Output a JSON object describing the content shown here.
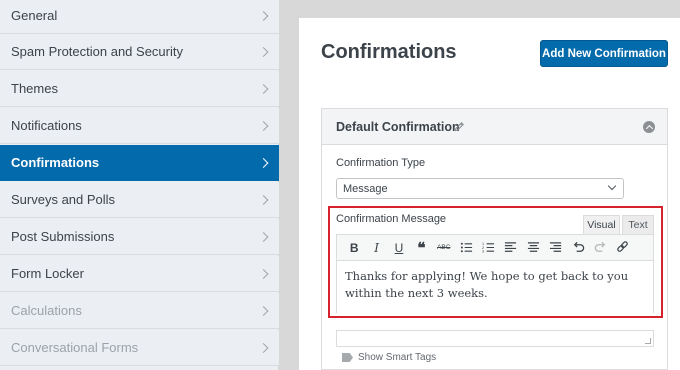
{
  "sidebar": {
    "items": [
      {
        "label": "General",
        "state": "normal"
      },
      {
        "label": "Spam Protection and Security",
        "state": "normal"
      },
      {
        "label": "Themes",
        "state": "normal"
      },
      {
        "label": "Notifications",
        "state": "normal"
      },
      {
        "label": "Confirmations",
        "state": "active"
      },
      {
        "label": "Surveys and Polls",
        "state": "normal"
      },
      {
        "label": "Post Submissions",
        "state": "normal"
      },
      {
        "label": "Form Locker",
        "state": "normal"
      },
      {
        "label": "Calculations",
        "state": "muted"
      },
      {
        "label": "Conversational Forms",
        "state": "muted"
      }
    ]
  },
  "main": {
    "title": "Confirmations",
    "add_button_label": "Add New Confirmation",
    "box": {
      "title": "Default Confirmation",
      "type_label": "Confirmation Type",
      "type_value": "Message",
      "message_label": "Confirmation Message",
      "tabs": {
        "visual": "Visual",
        "text": "Text"
      },
      "toolbar": [
        {
          "name": "bold-icon",
          "glyph": "B"
        },
        {
          "name": "italic-icon",
          "glyph": "I"
        },
        {
          "name": "underline-icon",
          "glyph": "U"
        },
        {
          "name": "blockquote-icon",
          "glyph": "❝"
        },
        {
          "name": "strikethrough-icon",
          "glyph": "ABC"
        },
        {
          "name": "bullet-list-icon",
          "glyph": ""
        },
        {
          "name": "numbered-list-icon",
          "glyph": ""
        },
        {
          "name": "align-left-icon",
          "glyph": ""
        },
        {
          "name": "align-center-icon",
          "glyph": ""
        },
        {
          "name": "align-right-icon",
          "glyph": ""
        },
        {
          "name": "undo-icon",
          "glyph": "↶"
        },
        {
          "name": "redo-icon",
          "glyph": "↷"
        },
        {
          "name": "link-icon",
          "glyph": ""
        }
      ],
      "message_text": "Thanks for applying! We hope to get back to you within the next 3 weeks.",
      "smart_tags_label": "Show Smart Tags"
    }
  },
  "colors": {
    "accent": "#036aab",
    "highlight_border": "#d6232b"
  }
}
